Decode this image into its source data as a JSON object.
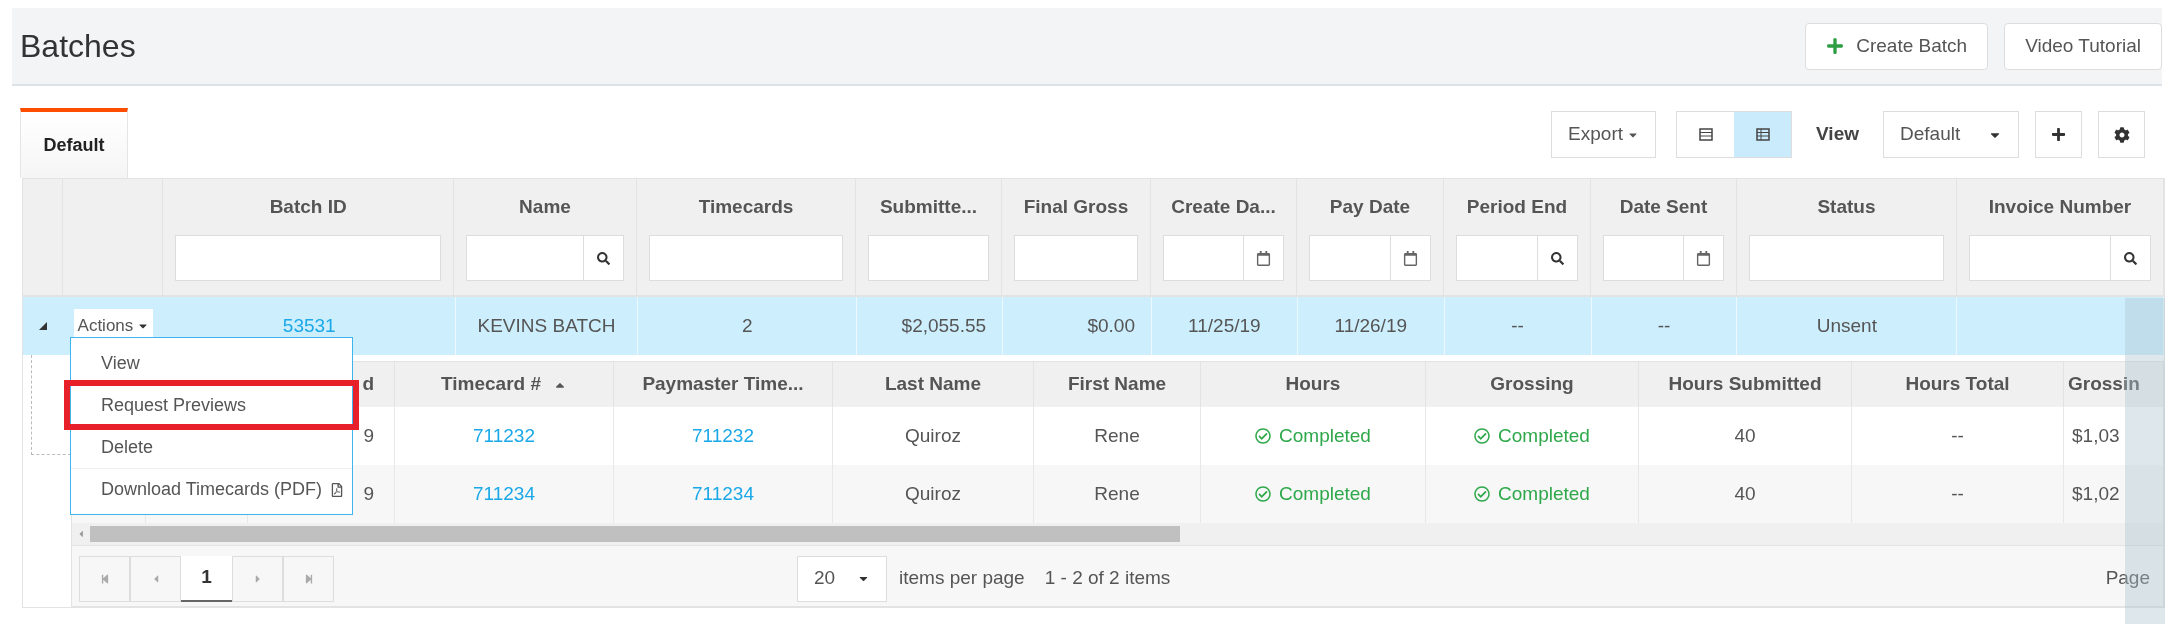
{
  "page_title": "Batches",
  "header_buttons": [
    {
      "kind": "create",
      "label": "Create Batch"
    },
    {
      "kind": "plain",
      "label": "Video Tutorial"
    }
  ],
  "tabs": [
    {
      "label": "Default",
      "selected": true
    }
  ],
  "toolbar": {
    "export": "Export",
    "view_modes": [
      {
        "kind": "list",
        "selected": false
      },
      {
        "kind": "grid",
        "selected": true
      }
    ],
    "view_label": "View",
    "view_value": "Default"
  },
  "columns": [
    {
      "label": "Batch ID",
      "kind": "text"
    },
    {
      "label": "Name",
      "kind": "search"
    },
    {
      "label": "Timecards",
      "kind": "text"
    },
    {
      "label": "Submitte...",
      "kind": "text"
    },
    {
      "label": "Final Gross",
      "kind": "text"
    },
    {
      "label": "Create Da...",
      "kind": "date"
    },
    {
      "label": "Pay Date",
      "kind": "date"
    },
    {
      "label": "Period End",
      "kind": "search"
    },
    {
      "label": "Date Sent",
      "kind": "date"
    },
    {
      "label": "Status",
      "kind": "text"
    },
    {
      "label": "Invoice Number",
      "kind": "search"
    }
  ],
  "rows": [
    {
      "expanded": true,
      "selected": true,
      "actions_label": "Actions",
      "cells": [
        "53531",
        "KEVINS BATCH",
        "2",
        "$2,055.55",
        "$0.00",
        "11/25/19",
        "11/26/19",
        "--",
        "--",
        "Unsent",
        ""
      ]
    }
  ],
  "actions_menu": [
    {
      "label": "View",
      "highlighted": false,
      "pdf": false
    },
    {
      "label": "Request Previews",
      "highlighted": true,
      "pdf": false
    },
    {
      "label": "Delete",
      "highlighted": false,
      "pdf": false
    },
    {
      "label": "Download Timecards (PDF)",
      "highlighted": false,
      "pdf": true
    }
  ],
  "detail": {
    "columns": [
      {
        "label": "d",
        "sorted": false
      },
      {
        "label": "Timecard #",
        "sorted": true
      },
      {
        "label": "Paymaster Time...",
        "sorted": false
      },
      {
        "label": "Last Name",
        "sorted": false
      },
      {
        "label": "First Name",
        "sorted": false
      },
      {
        "label": "Hours",
        "sorted": false
      },
      {
        "label": "Grossing",
        "sorted": false
      },
      {
        "label": "Hours Submitted",
        "sorted": false
      },
      {
        "label": "Hours Total",
        "sorted": false
      },
      {
        "label": "Grossin",
        "sorted": false
      }
    ],
    "rows": [
      {
        "cells": [
          {
            "kind": "text",
            "text": "9"
          },
          {
            "kind": "link",
            "text": "711232"
          },
          {
            "kind": "link",
            "text": "711232"
          },
          {
            "kind": "text",
            "text": "Quiroz"
          },
          {
            "kind": "text",
            "text": "Rene"
          },
          {
            "kind": "status",
            "text": "Completed"
          },
          {
            "kind": "status",
            "text": "Completed"
          },
          {
            "kind": "text",
            "text": "40"
          },
          {
            "kind": "text",
            "text": "--"
          },
          {
            "kind": "right",
            "text": "$1,03"
          }
        ]
      },
      {
        "cells": [
          {
            "kind": "text",
            "text": "9"
          },
          {
            "kind": "link",
            "text": "711234"
          },
          {
            "kind": "link",
            "text": "711234"
          },
          {
            "kind": "text",
            "text": "Quiroz"
          },
          {
            "kind": "text",
            "text": "Rene"
          },
          {
            "kind": "status",
            "text": "Completed"
          },
          {
            "kind": "status",
            "text": "Completed"
          },
          {
            "kind": "text",
            "text": "40"
          },
          {
            "kind": "text",
            "text": "--"
          },
          {
            "kind": "right",
            "text": "$1,02"
          }
        ]
      }
    ],
    "pager": {
      "pages": [
        {
          "label": "1",
          "selected": true
        }
      ],
      "page_size": "20",
      "per_page_label": "items per page",
      "summary": "1 - 2 of 2 items",
      "page_label": "Page"
    }
  }
}
